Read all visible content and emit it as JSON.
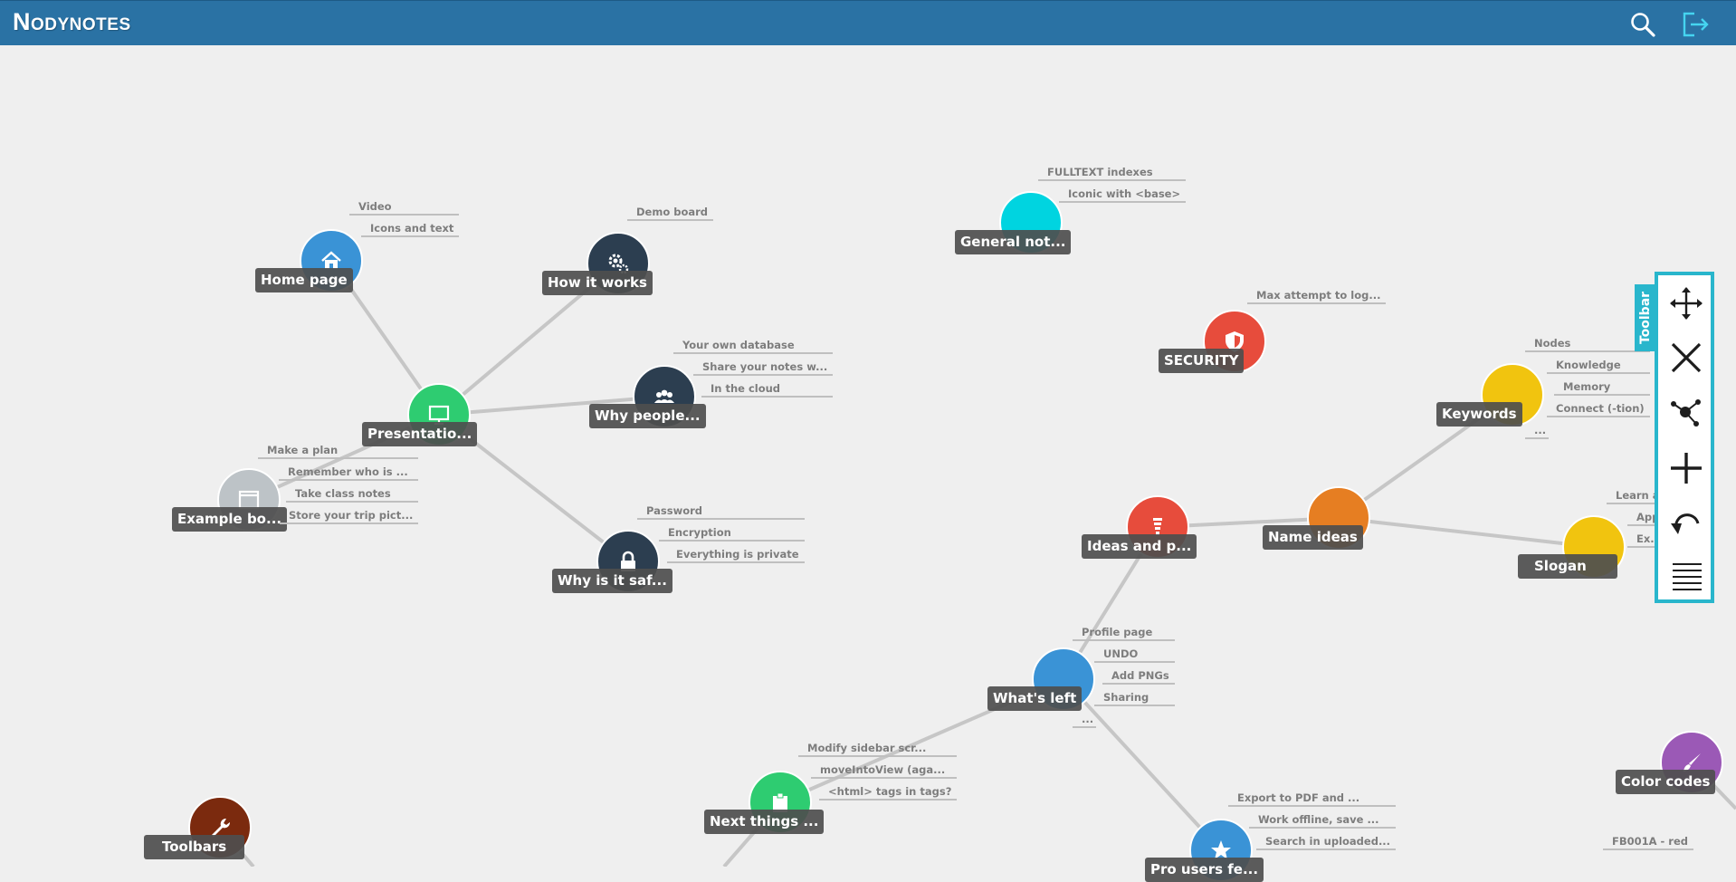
{
  "app": {
    "title": "Nodynotes",
    "accent_color": "#2a72a4",
    "icons": [
      "search-icon",
      "logout-icon"
    ]
  },
  "toolbar": {
    "label": "Toolbar",
    "accent_color": "#29b6cc",
    "tools": [
      "move-icon",
      "delete-icon",
      "connect-icon",
      "add-icon",
      "undo-icon",
      "list-icon"
    ]
  },
  "nodes": [
    {
      "id": "home",
      "label": "Home page",
      "color": "#3a93d6",
      "icon": "home-icon",
      "tags": [
        "Video",
        "Icons and text"
      ]
    },
    {
      "id": "howit",
      "label": "How it works",
      "color": "#2c3e50",
      "icon": "gears-icon",
      "tags": [
        "Demo board"
      ]
    },
    {
      "id": "why",
      "label": "Why people...",
      "color": "#2c3e50",
      "icon": "people-icon",
      "tags": [
        "Your own database",
        "Share your notes w...",
        "In the cloud"
      ]
    },
    {
      "id": "pres",
      "label": "Presentatio...",
      "color": "#2ecc71",
      "icon": "monitor-icon",
      "tags": []
    },
    {
      "id": "example",
      "label": "Example bo...",
      "color": "#bdc3c7",
      "icon": "window-icon",
      "tags": [
        "Make a plan",
        "Remember who is ...",
        "Take class notes",
        "Store your trip pict..."
      ]
    },
    {
      "id": "safe",
      "label": "Why is it saf...",
      "color": "#2c3e50",
      "icon": "lock-icon",
      "tags": [
        "Password",
        "Encryption",
        "Everything is private"
      ]
    },
    {
      "id": "general",
      "label": "General not...",
      "color": "#00d4e0",
      "icon": "",
      "tags": [
        "FULLTEXT indexes",
        "Iconic with <base>"
      ]
    },
    {
      "id": "security",
      "label": "SECURITY",
      "color": "#e74c3c",
      "icon": "shield-icon",
      "tags": [
        "Max attempt to log..."
      ]
    },
    {
      "id": "keywords",
      "label": "Keywords",
      "color": "#f1c40f",
      "icon": "",
      "tags": [
        "Nodes",
        "Knowledge",
        "Memory",
        "Connect (-tion)",
        "..."
      ]
    },
    {
      "id": "ideas",
      "label": "Ideas and p...",
      "color": "#e74c3c",
      "icon": "bulb-icon",
      "tags": []
    },
    {
      "id": "name",
      "label": "Name ideas",
      "color": "#e67e22",
      "icon": "",
      "tags": []
    },
    {
      "id": "slogan",
      "label": "Slogan",
      "color": "#f1c40f",
      "icon": "",
      "tags": [
        "Learn and...",
        "Appl...",
        "Ex..."
      ]
    },
    {
      "id": "left",
      "label": "What's left",
      "color": "#3a93d6",
      "icon": "",
      "tags": [
        "Profile page",
        "UNDO",
        "Add PNGs",
        "Sharing",
        "..."
      ]
    },
    {
      "id": "next",
      "label": "Next things ...",
      "color": "#2ecc71",
      "icon": "clipboard-icon",
      "tags": [
        "Modify sidebar scr...",
        "moveIntoView (aga...",
        "<html> tags in tags?"
      ]
    },
    {
      "id": "prousers",
      "label": "Pro users fe...",
      "color": "#3a93d6",
      "icon": "star-icon",
      "tags": [
        "Export to PDF and ...",
        "Work offline, save ...",
        "Search in uploaded..."
      ]
    },
    {
      "id": "colors",
      "label": "Color codes",
      "color": "#9b59b6",
      "icon": "brush-icon",
      "tags": [
        "FB001A - red"
      ]
    },
    {
      "id": "toolbars",
      "label": "Toolbars",
      "color": "#7b2a0e",
      "icon": "wrench-icon",
      "tags": []
    }
  ]
}
